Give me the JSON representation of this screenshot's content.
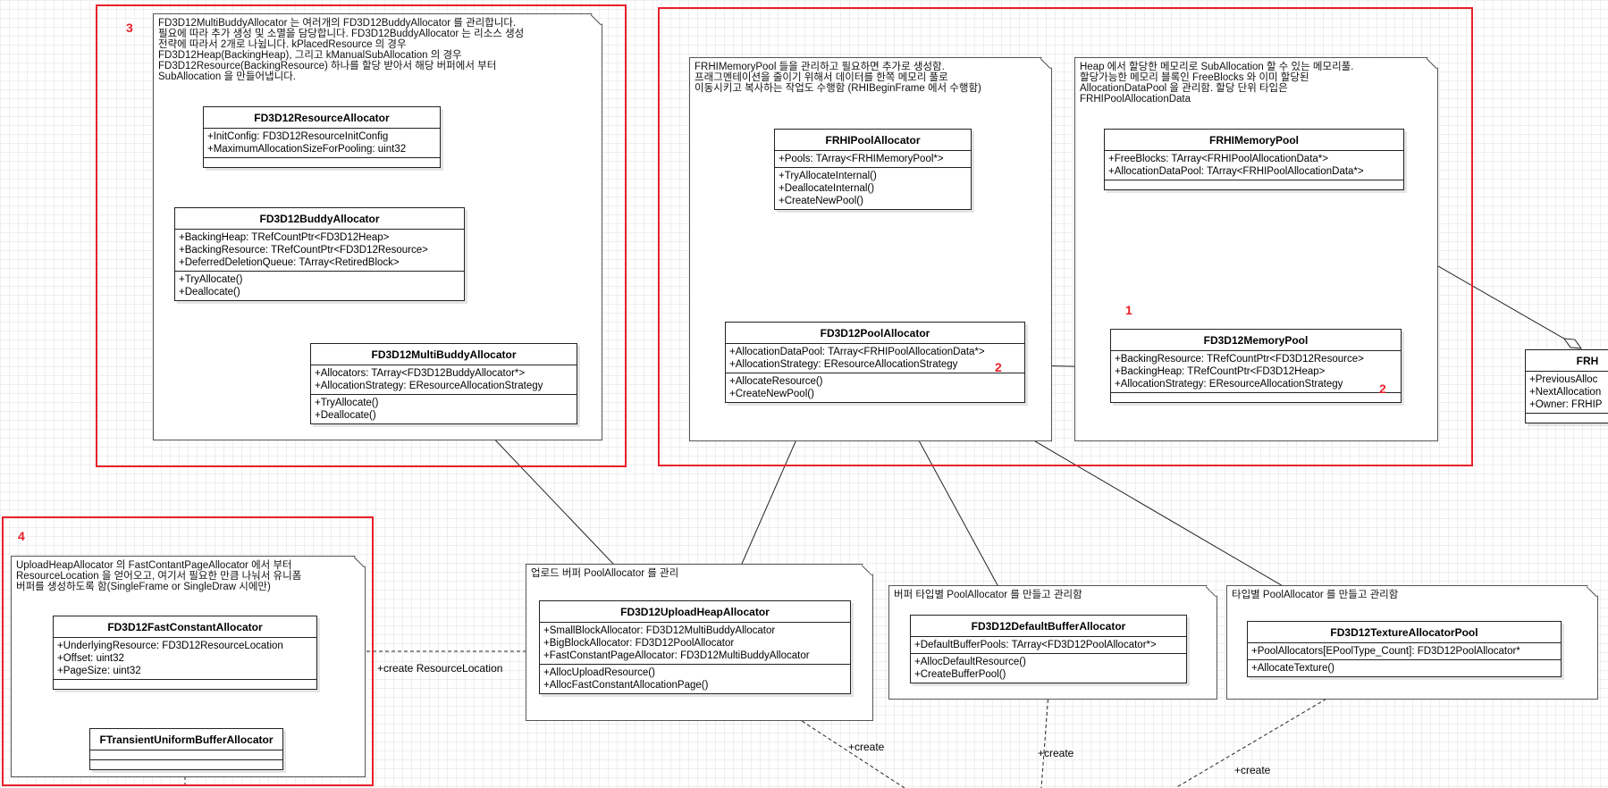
{
  "groups": [
    {
      "id": "g1",
      "label": "3"
    },
    {
      "id": "g2",
      "label": ""
    },
    {
      "id": "g3",
      "label": "4"
    }
  ],
  "markers": {
    "m1": "1",
    "m2a": "2",
    "m2b": "2"
  },
  "notes": {
    "n_multibuddy": "FD3D12MultiBuddyAllocator 는 여러개의 FD3D12BuddyAllocator 를 관리합니다.\n필요에 따라 추가 생성 및 소멸을 담당합니다. FD3D12BuddyAllocator 는 리소스 생성\n전략에 따라서 2개로 나뉩니다. kPlacedResource 의 경우\nFD3D12Heap(BackingHeap), 그리고 kManualSubAllocation 의 경우\nFD3D12Resource(BackingResource) 하나를 할당 받아서 해당 버퍼에서 부터\nSubAllocation 을 만들어냅니다.",
    "n_rhipool": "FRHIMemoryPool 들을 관리하고 필요하면 추가로 생성함.\n프래그멘테이션을 줄이기 위해서 데이터를 한쪽 메모리 풀로\n이동시키고 복사하는 작업도 수행함 (RHIBeginFrame 에서 수행함)",
    "n_heap": "Heap 에서 할당한 메모리로 SubAllocation 할 수 있는 메모리풀.\n할당가능한 메모리 블록인 FreeBlocks 와 이미 할당된\nAllocationDataPool 을 관리함. 할당 단위 타입은\nFRHIPoolAllocationData",
    "n_uploadheap": "UploadHeapAllocator 의 FastContantPageAllocator 에서 부터\nResourceLocation 을 얻어오고, 여기서 필요한 만큼 나눠서 유니폼\n버퍼를 생성하도록 함(SingleFrame or SingleDraw 시에만)",
    "n_uploadbuf": "업로드 버퍼 PoolAllocator 를 관리",
    "n_buffertype": "버퍼 타입별 PoolAllocator 를 만들고 관리함",
    "n_typepool": "타입별 PoolAllocator 를 만들고 관리함"
  },
  "classes": {
    "resourceAllocator": {
      "name": "FD3D12ResourceAllocator",
      "attrs": [
        "+InitConfig: FD3D12ResourceInitConfig",
        "+MaximumAllocationSizeForPooling: uint32"
      ],
      "ops": []
    },
    "buddyAllocator": {
      "name": "FD3D12BuddyAllocator",
      "attrs": [
        "+BackingHeap: TRefCountPtr<FD3D12Heap>",
        "+BackingResource: TRefCountPtr<FD3D12Resource>",
        "+DeferredDeletionQueue: TArray<RetiredBlock>"
      ],
      "ops": [
        "+TryAllocate()",
        "+Deallocate()"
      ]
    },
    "multiBuddyAllocator": {
      "name": "FD3D12MultiBuddyAllocator",
      "attrs": [
        "+Allocators: TArray<FD3D12BuddyAllocator*>",
        "+AllocationStrategy: EResourceAllocationStrategy"
      ],
      "ops": [
        "+TryAllocate()",
        "+Deallocate()"
      ]
    },
    "rhiPoolAllocator": {
      "name": "FRHIPoolAllocator",
      "attrs": [
        "+Pools: TArray<FRHIMemoryPool*>"
      ],
      "ops": [
        "+TryAllocateInternal()",
        "+DeallocateInternal()",
        "+CreateNewPool()"
      ]
    },
    "poolAllocator": {
      "name": "FD3D12PoolAllocator",
      "attrs": [
        "+AllocationDataPool: TArray<FRHIPoolAllocationData*>",
        "+AllocationStrategy: EResourceAllocationStrategy"
      ],
      "ops": [
        "+AllocateResource()",
        "+CreateNewPool()"
      ]
    },
    "rhiMemoryPool": {
      "name": "FRHIMemoryPool",
      "attrs": [
        "+FreeBlocks: TArray<FRHIPoolAllocationData*>",
        "+AllocationDataPool: TArray<FRHIPoolAllocationData*>"
      ],
      "ops": []
    },
    "memoryPool": {
      "name": "FD3D12MemoryPool",
      "attrs": [
        "+BackingResource: TRefCountPtr<FD3D12Resource>",
        "+BackingHeap: TRefCountPtr<FD3D12Heap>",
        "+AllocationStrategy: EResourceAllocationStrategy"
      ],
      "ops": []
    },
    "rhiPoolAllocationData": {
      "name": "FRH",
      "attrs": [
        "+PreviousAlloc",
        "+NextAllocation",
        "+Owner: FRHIP"
      ],
      "ops": []
    },
    "uploadHeapAllocator": {
      "name": "FD3D12UploadHeapAllocator",
      "attrs": [
        "+SmallBlockAllocator: FD3D12MultiBuddyAllocator",
        "+BigBlockAllocator: FD3D12PoolAllocator",
        "+FastConstantPageAllocator: FD3D12MultiBuddyAllocator"
      ],
      "ops": [
        "+AllocUploadResource()",
        "+AllocFastConstantAllocationPage()"
      ]
    },
    "fastConstantAllocator": {
      "name": "FD3D12FastConstantAllocator",
      "attrs": [
        "+UnderlyingResource: FD3D12ResourceLocation",
        "+Offset: uint32",
        "+PageSize: uint32"
      ],
      "ops": []
    },
    "transientUniformBufferAllocator": {
      "name": "FTransientUniformBufferAllocator",
      "attrs": [],
      "ops": []
    },
    "defaultBufferAllocator": {
      "name": "FD3D12DefaultBufferAllocator",
      "attrs": [
        "+DefaultBufferPools: TArray<FD3D12PoolAllocator*>"
      ],
      "ops": [
        "+AllocDefaultResource()",
        "+CreateBufferPool()"
      ]
    },
    "textureAllocatorPool": {
      "name": "FD3D12TextureAllocatorPool",
      "attrs": [
        "+PoolAllocators[EPoolType_Count]: FD3D12PoolAllocator*"
      ],
      "ops": [
        "+AllocateTexture()"
      ]
    }
  },
  "edgeLabels": {
    "createResourceLocation": "+create ResourceLocation",
    "create1": "+create",
    "create2": "+create",
    "create3": "+create"
  }
}
